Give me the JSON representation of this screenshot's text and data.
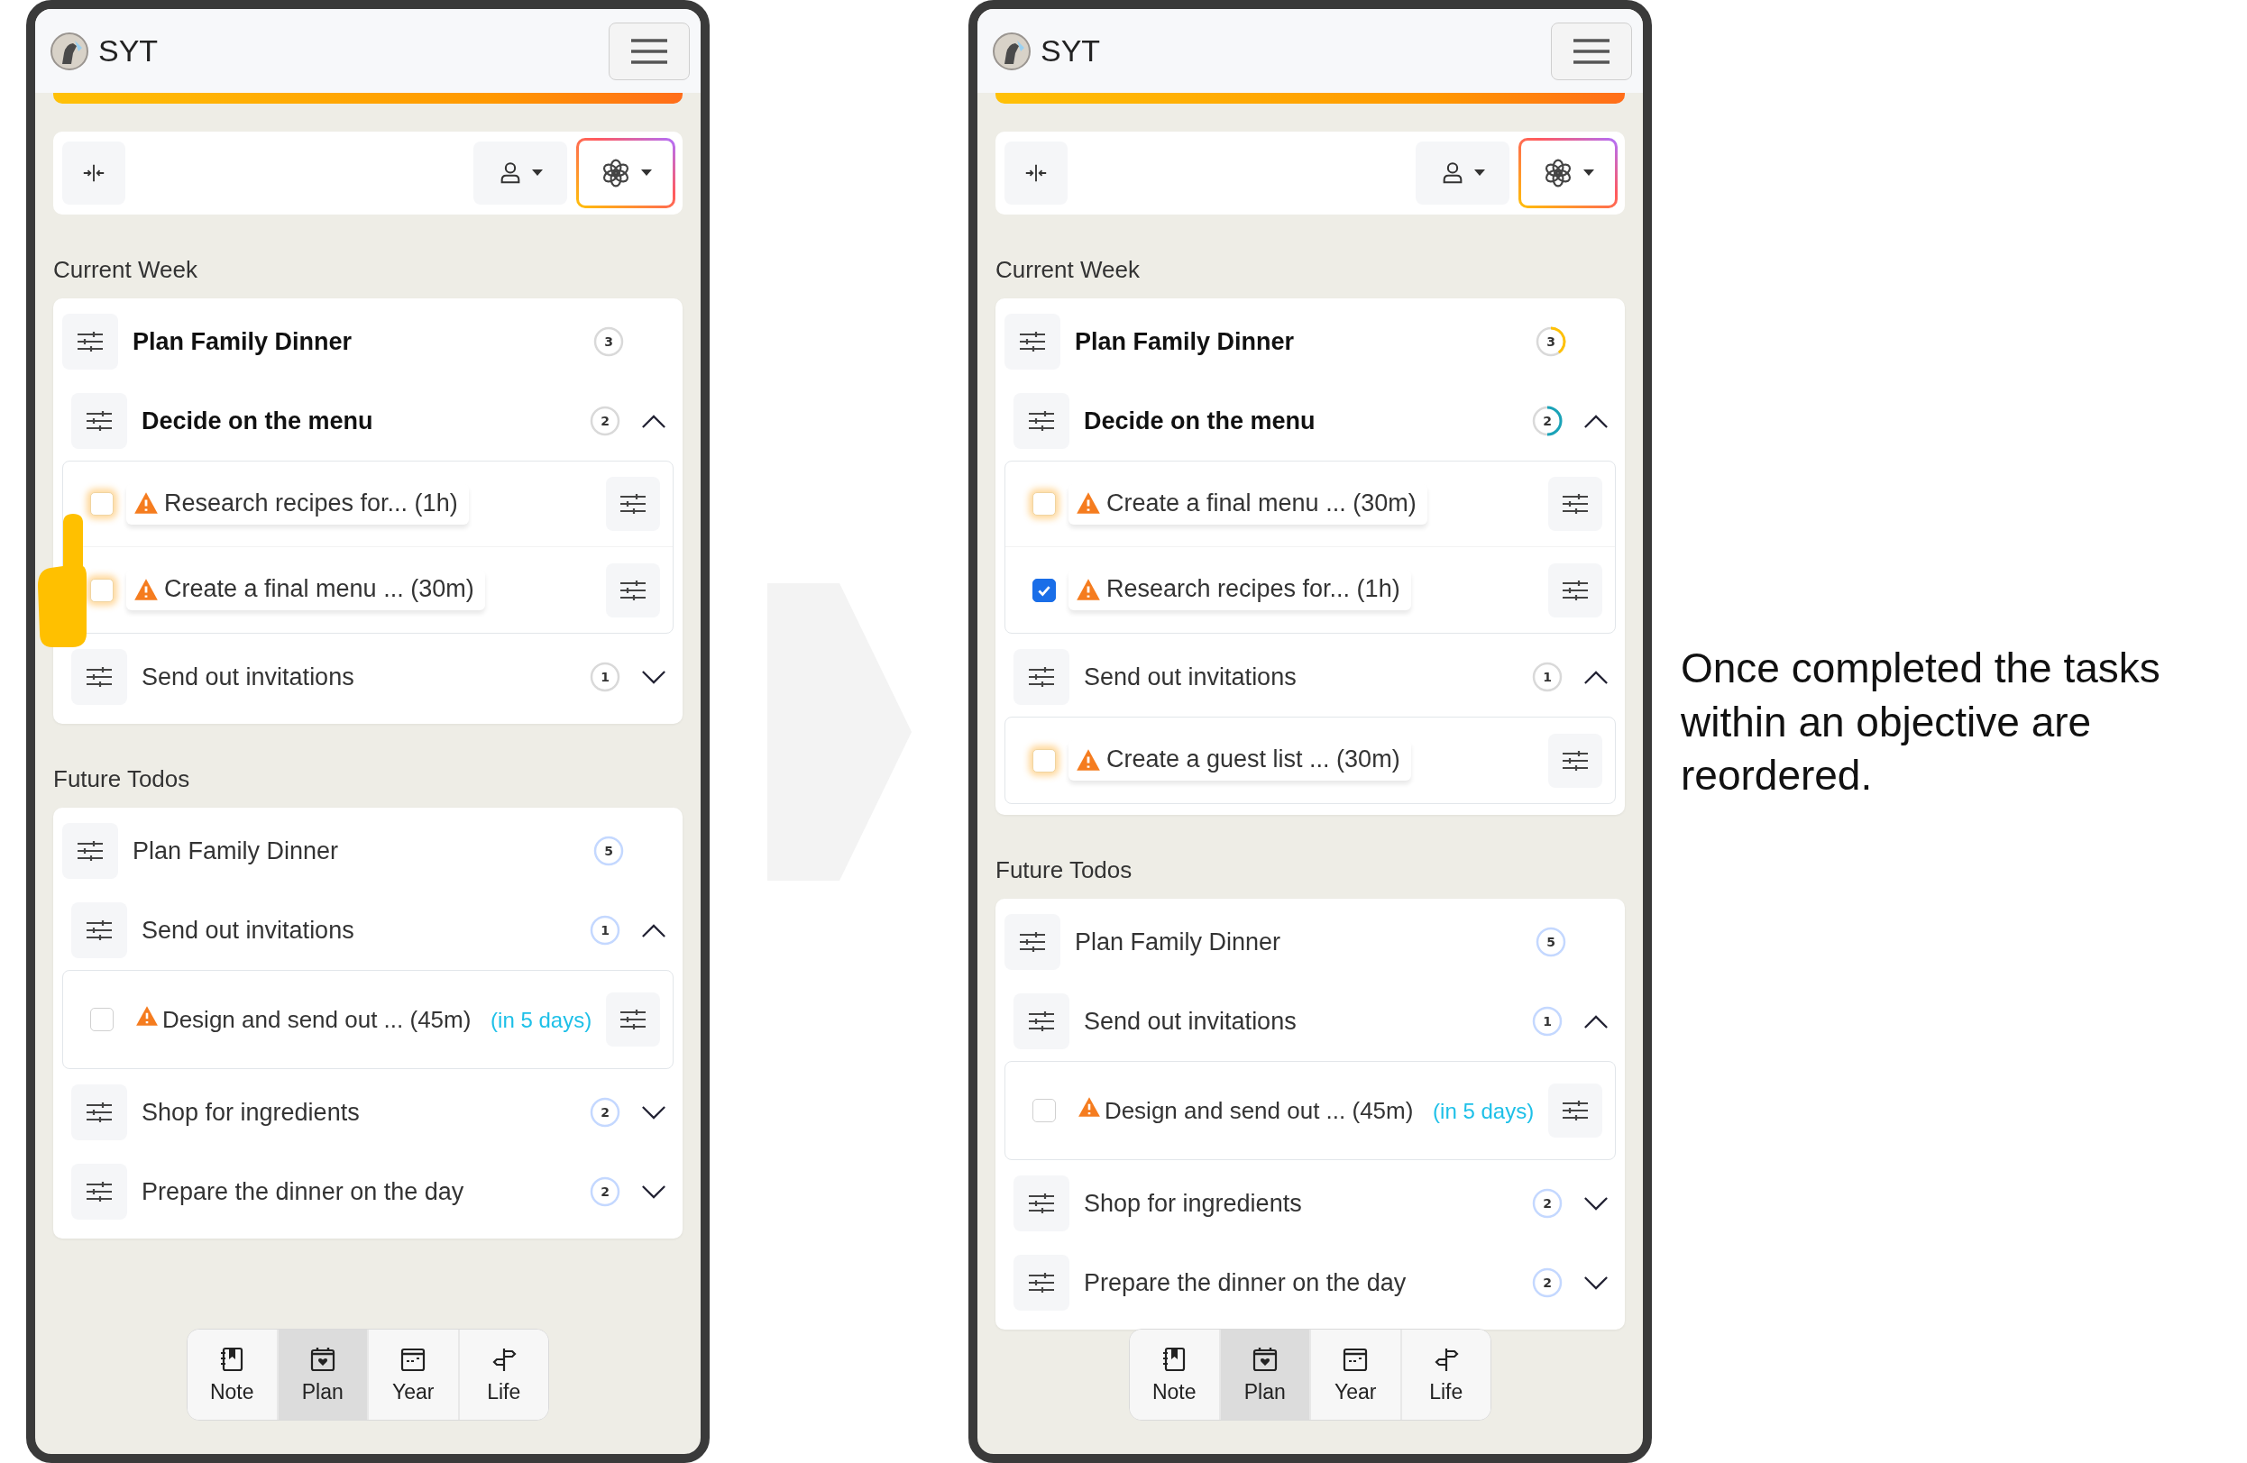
{
  "phones": [
    {
      "app_name": "SYT",
      "hand_pointer": true,
      "sections": [
        {
          "kind": "current",
          "title": "Current Week",
          "objectives": [
            {
              "title": "Plan Family Dinner",
              "emphasized": true,
              "count": "3",
              "in_progress": false,
              "goals": [
                {
                  "title": "Decide on the menu",
                  "emphasized": true,
                  "count": "2",
                  "in_progress": false,
                  "expanded": true,
                  "tasks": [
                    {
                      "title": "Research recipes for... (1h)",
                      "checked": false,
                      "focused": true
                    },
                    {
                      "title": "Create a final menu ... (30m)",
                      "checked": false,
                      "focused": true
                    }
                  ]
                },
                {
                  "title": "Send out invitations",
                  "emphasized": false,
                  "count": "1",
                  "in_progress": false,
                  "expanded": false
                }
              ]
            }
          ]
        },
        {
          "kind": "future",
          "title": "Future Todos",
          "objectives": [
            {
              "title": "Plan Family Dinner",
              "emphasized": false,
              "count": "5",
              "in_progress": false,
              "goals": [
                {
                  "title": "Send out invitations",
                  "emphasized": false,
                  "count": "1",
                  "in_progress": false,
                  "expanded": true,
                  "tasks": [
                    {
                      "title": "Design and send out ... (45m)",
                      "due": "(in 5 days)",
                      "checked": false,
                      "focused": false
                    }
                  ]
                },
                {
                  "title": "Shop for ingredients",
                  "emphasized": false,
                  "count": "2",
                  "in_progress": false,
                  "expanded": false
                },
                {
                  "title": "Prepare the dinner on the day",
                  "emphasized": false,
                  "count": "2",
                  "in_progress": false,
                  "expanded": false
                }
              ]
            }
          ]
        }
      ],
      "nav": [
        {
          "kind": "note",
          "label": "Note",
          "selected": false
        },
        {
          "kind": "plan",
          "label": "Plan",
          "selected": true
        },
        {
          "kind": "year",
          "label": "Year",
          "selected": false
        },
        {
          "kind": "life",
          "label": "Life",
          "selected": false
        }
      ]
    },
    {
      "app_name": "SYT",
      "hand_pointer": false,
      "sections": [
        {
          "kind": "current",
          "title": "Current Week",
          "objectives": [
            {
              "title": "Plan Family Dinner",
              "emphasized": true,
              "count": "3",
              "in_progress": true,
              "goals": [
                {
                  "title": "Decide on the menu",
                  "emphasized": true,
                  "count": "2",
                  "in_progress": true,
                  "expanded": true,
                  "tasks": [
                    {
                      "title": "Create a final menu ... (30m)",
                      "checked": false,
                      "focused": true
                    },
                    {
                      "title": "Research recipes for... (1h)",
                      "checked": true,
                      "focused": false
                    }
                  ]
                },
                {
                  "title": "Send out invitations",
                  "emphasized": false,
                  "count": "1",
                  "in_progress": false,
                  "expanded": true,
                  "tasks": [
                    {
                      "title": "Create a guest list ... (30m)",
                      "checked": false,
                      "focused": true
                    }
                  ]
                }
              ]
            }
          ]
        },
        {
          "kind": "future",
          "title": "Future Todos",
          "objectives": [
            {
              "title": "Plan Family Dinner",
              "emphasized": false,
              "count": "5",
              "in_progress": false,
              "goals": [
                {
                  "title": "Send out invitations",
                  "emphasized": false,
                  "count": "1",
                  "in_progress": false,
                  "expanded": true,
                  "tasks": [
                    {
                      "title": "Design and send out ... (45m)",
                      "due": "(in 5 days)",
                      "checked": false,
                      "focused": false
                    }
                  ]
                },
                {
                  "title": "Shop for ingredients",
                  "emphasized": false,
                  "count": "2",
                  "in_progress": false,
                  "expanded": false
                },
                {
                  "title": "Prepare the dinner on the day",
                  "emphasized": false,
                  "count": "2",
                  "in_progress": false,
                  "expanded": false
                }
              ]
            }
          ]
        }
      ],
      "nav": [
        {
          "kind": "note",
          "label": "Note",
          "selected": false
        },
        {
          "kind": "plan",
          "label": "Plan",
          "selected": true
        },
        {
          "kind": "year",
          "label": "Year",
          "selected": false
        },
        {
          "kind": "life",
          "label": "Life",
          "selected": false
        }
      ]
    }
  ],
  "caption": "Once completed the tasks within an objective are reordered."
}
